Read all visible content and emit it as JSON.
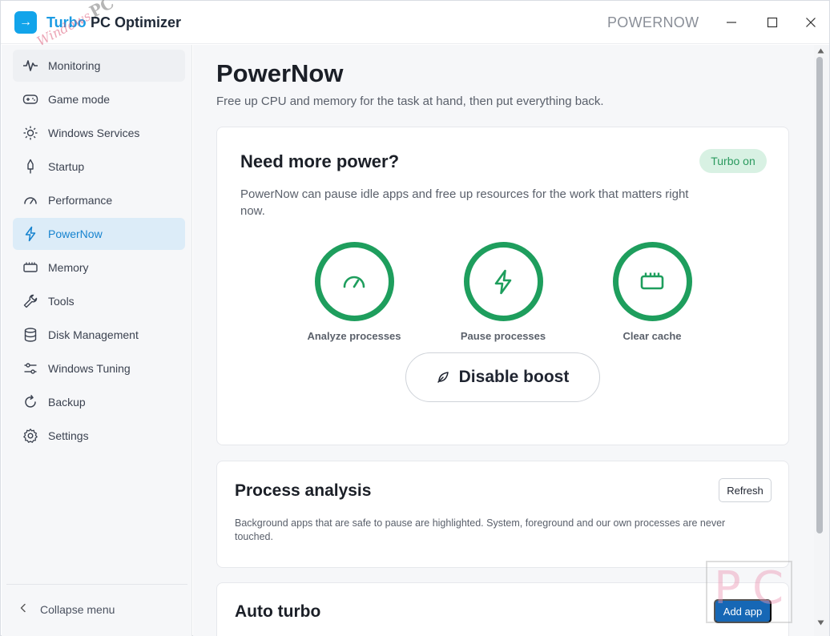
{
  "app": {
    "logo_glyph": "→",
    "title_brand": "Turbo",
    "title_product": "PC Optimizer",
    "context_title": "POWERNOW"
  },
  "watermark": {
    "script_text": "Windows",
    "pc_text": "PC"
  },
  "sidebar": {
    "items": [
      {
        "label": "Monitoring",
        "icon": "pulse-icon"
      },
      {
        "label": "Game mode",
        "icon": "gamepad-icon"
      },
      {
        "label": "Windows Services",
        "icon": "sun-icon"
      },
      {
        "label": "Startup",
        "icon": "rocket-icon"
      },
      {
        "label": "Performance",
        "icon": "gauge-icon"
      },
      {
        "label": "PowerNow",
        "icon": "bolt-icon",
        "active": true
      },
      {
        "label": "Memory",
        "icon": "memory-icon"
      },
      {
        "label": "Tools",
        "icon": "wrench-icon"
      },
      {
        "label": "Disk Management",
        "icon": "database-icon"
      },
      {
        "label": "Windows Tuning",
        "icon": "sliders-icon"
      },
      {
        "label": "Backup",
        "icon": "refresh-icon"
      },
      {
        "label": "Settings",
        "icon": "gear-icon"
      }
    ],
    "collapse_label": "Collapse menu"
  },
  "main": {
    "title": "PowerNow",
    "subtitle": "Free up CPU and memory for the task at hand, then put everything back.",
    "power_card": {
      "title": "Need more power?",
      "badge": "Turbo on",
      "description": "PowerNow can pause idle apps and free up resources for the work that matters right now.",
      "actions": [
        {
          "label": "Analyze processes",
          "icon": "gauge-icon"
        },
        {
          "label": "Pause processes",
          "icon": "bolt-icon"
        },
        {
          "label": "Clear cache",
          "icon": "memory-icon"
        }
      ],
      "boost_label": "Disable boost"
    },
    "process_card": {
      "title": "Process analysis",
      "refresh_label": "Refresh",
      "description": "Background apps that are safe to pause are highlighted. System, foreground and our own processes are never touched."
    },
    "auto_card": {
      "title": "Auto turbo",
      "add_label": "Add app"
    }
  },
  "colors": {
    "accent": "#1683cf",
    "success": "#1e9e5d",
    "primary_button": "#1667b5"
  }
}
